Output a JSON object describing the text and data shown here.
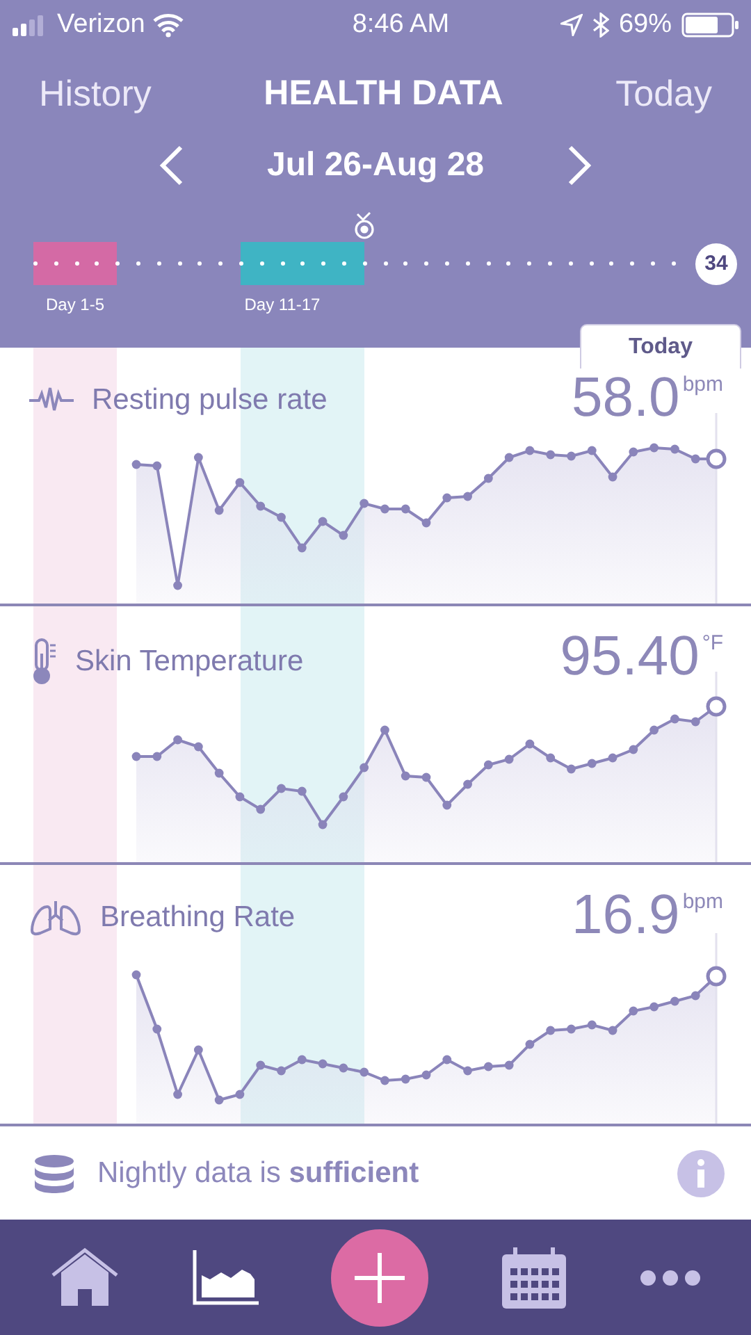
{
  "status_bar": {
    "carrier": "Verizon",
    "time": "8:46 AM",
    "battery": "69%"
  },
  "header": {
    "left_link": "History",
    "title": "HEALTH DATA",
    "right_link": "Today"
  },
  "date_range": {
    "label": "Jul 26-Aug 28"
  },
  "timeline": {
    "segments": [
      {
        "label": "Day 1-5",
        "color": "#d46aa5"
      },
      {
        "label": "Day 11-17",
        "color": "#3fb4c4"
      }
    ],
    "day_badge": "34"
  },
  "today_button": "Today",
  "metrics": [
    {
      "kind": "pulse",
      "name": "Resting pulse rate",
      "value": "58.0",
      "unit": "bpm"
    },
    {
      "kind": "temperature",
      "name": "Skin Temperature",
      "value": "95.40",
      "unit": "°F"
    },
    {
      "kind": "breathing",
      "name": "Breathing Rate",
      "value": "16.9",
      "unit": "bpm"
    }
  ],
  "footer": {
    "message": "Nightly data is **sufficient**"
  },
  "nav": [
    {
      "kind": "home",
      "selected": false
    },
    {
      "kind": "chart",
      "selected": true
    },
    {
      "kind": "add",
      "selected": false
    },
    {
      "kind": "calendar",
      "selected": false
    },
    {
      "kind": "more",
      "selected": false
    }
  ]
}
